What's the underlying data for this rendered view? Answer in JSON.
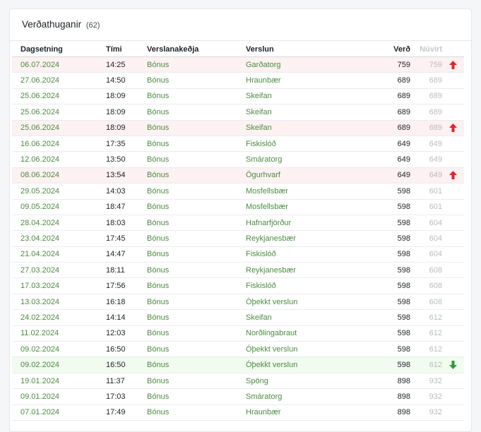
{
  "header": {
    "title": "Verðathuganir",
    "count": "(62)"
  },
  "columns": {
    "date": "Dagsetning",
    "time": "Tími",
    "chain": "Verslanakeðja",
    "store": "Verslun",
    "price": "Verð",
    "current": "Núvirt"
  },
  "colors": {
    "up_arrow": "#e3232a",
    "down_arrow": "#2e9b3a",
    "link": "#4c8c42"
  },
  "rows": [
    {
      "date": "06.07.2024",
      "time": "14:25",
      "chain": "Bónus",
      "store": "Garðatorg",
      "price": "759",
      "current": "759",
      "trend": "up"
    },
    {
      "date": "27.06.2024",
      "time": "14:50",
      "chain": "Bónus",
      "store": "Hraunbær",
      "price": "689",
      "current": "689",
      "trend": ""
    },
    {
      "date": "25.06.2024",
      "time": "18:09",
      "chain": "Bónus",
      "store": "Skeifan",
      "price": "689",
      "current": "689",
      "trend": ""
    },
    {
      "date": "25.06.2024",
      "time": "18:09",
      "chain": "Bónus",
      "store": "Skeifan",
      "price": "689",
      "current": "689",
      "trend": ""
    },
    {
      "date": "25.06.2024",
      "time": "18:09",
      "chain": "Bónus",
      "store": "Skeifan",
      "price": "689",
      "current": "689",
      "trend": "up"
    },
    {
      "date": "16.06.2024",
      "time": "17:35",
      "chain": "Bónus",
      "store": "Fiskislóð",
      "price": "649",
      "current": "649",
      "trend": ""
    },
    {
      "date": "12.06.2024",
      "time": "13:50",
      "chain": "Bónus",
      "store": "Smáratorg",
      "price": "649",
      "current": "649",
      "trend": ""
    },
    {
      "date": "08.06.2024",
      "time": "13:54",
      "chain": "Bónus",
      "store": "Ögurhvarf",
      "price": "649",
      "current": "649",
      "trend": "up"
    },
    {
      "date": "29.05.2024",
      "time": "14:03",
      "chain": "Bónus",
      "store": "Mosfellsbær",
      "price": "598",
      "current": "601",
      "trend": ""
    },
    {
      "date": "09.05.2024",
      "time": "18:47",
      "chain": "Bónus",
      "store": "Mosfellsbær",
      "price": "598",
      "current": "601",
      "trend": ""
    },
    {
      "date": "28.04.2024",
      "time": "18:03",
      "chain": "Bónus",
      "store": "Hafnarfjörður",
      "price": "598",
      "current": "604",
      "trend": ""
    },
    {
      "date": "23.04.2024",
      "time": "17:45",
      "chain": "Bónus",
      "store": "Reykjanesbær",
      "price": "598",
      "current": "604",
      "trend": ""
    },
    {
      "date": "21.04.2024",
      "time": "14:47",
      "chain": "Bónus",
      "store": "Fiskislóð",
      "price": "598",
      "current": "604",
      "trend": ""
    },
    {
      "date": "27.03.2024",
      "time": "18:11",
      "chain": "Bónus",
      "store": "Reykjanesbær",
      "price": "598",
      "current": "608",
      "trend": ""
    },
    {
      "date": "17.03.2024",
      "time": "17:56",
      "chain": "Bónus",
      "store": "Fiskislóð",
      "price": "598",
      "current": "608",
      "trend": ""
    },
    {
      "date": "13.03.2024",
      "time": "16:18",
      "chain": "Bónus",
      "store": "Óþekkt verslun",
      "price": "598",
      "current": "608",
      "trend": ""
    },
    {
      "date": "24.02.2024",
      "time": "14:14",
      "chain": "Bónus",
      "store": "Skeifan",
      "price": "598",
      "current": "612",
      "trend": ""
    },
    {
      "date": "11.02.2024",
      "time": "12:03",
      "chain": "Bónus",
      "store": "Norðlingabraut",
      "price": "598",
      "current": "612",
      "trend": ""
    },
    {
      "date": "09.02.2024",
      "time": "16:50",
      "chain": "Bónus",
      "store": "Óþekkt verslun",
      "price": "598",
      "current": "612",
      "trend": ""
    },
    {
      "date": "09.02.2024",
      "time": "16:50",
      "chain": "Bónus",
      "store": "Óþekkt verslun",
      "price": "598",
      "current": "612",
      "trend": "down"
    },
    {
      "date": "19.01.2024",
      "time": "11:37",
      "chain": "Bónus",
      "store": "Spöng",
      "price": "898",
      "current": "932",
      "trend": ""
    },
    {
      "date": "09.01.2024",
      "time": "17:03",
      "chain": "Bónus",
      "store": "Smáratorg",
      "price": "898",
      "current": "932",
      "trend": ""
    },
    {
      "date": "07.01.2024",
      "time": "17:49",
      "chain": "Bónus",
      "store": "Hraunbær",
      "price": "898",
      "current": "932",
      "trend": ""
    }
  ]
}
